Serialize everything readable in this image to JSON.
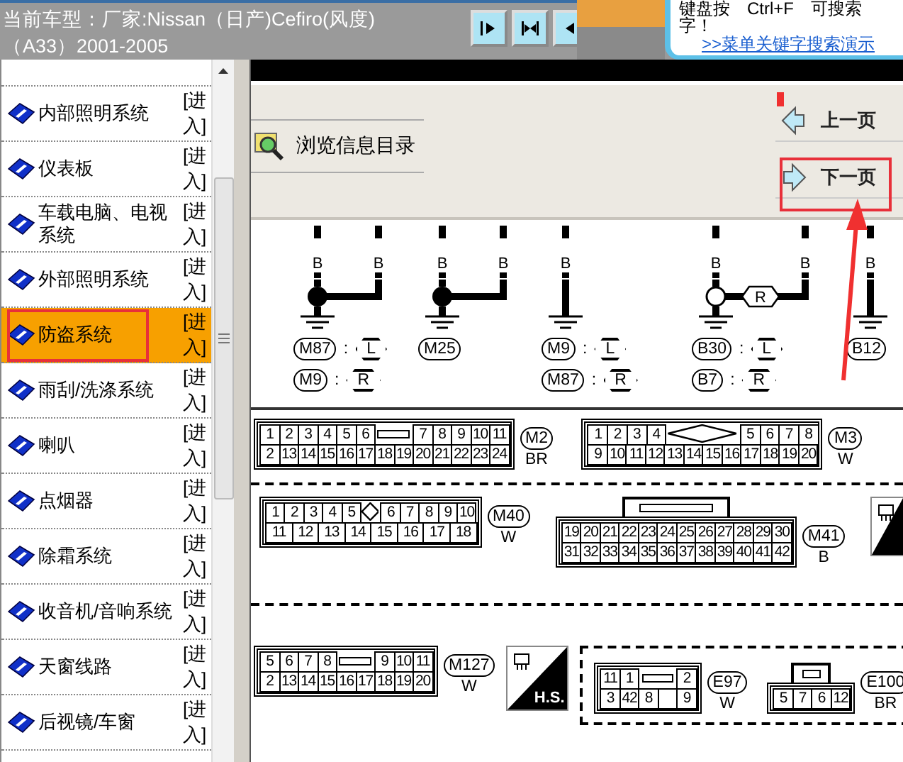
{
  "header": {
    "car_model": [
      "当前车型：厂家:Nissan（日产)Cefiro(风度)",
      "（A33）2001-2005"
    ],
    "toolbar_buttons": [
      {
        "kind": "arrow-right"
      },
      {
        "kind": "arrows-in"
      },
      {
        "kind": "arrow-left"
      }
    ],
    "tip": {
      "lines": [
        "键盘按　Ctrl+F　可搜索",
        "字！"
      ],
      "link": ">>菜单关键字搜索演示"
    }
  },
  "sidebar": {
    "items": [
      {
        "label": "内部照明系统",
        "action": "[进入]",
        "selected": false
      },
      {
        "label": "仪表板",
        "action": "[进入]",
        "selected": false
      },
      {
        "label": "车载电脑、电视系统",
        "action": "[进入]",
        "selected": false
      },
      {
        "label": "外部照明系统",
        "action": "[进入]",
        "selected": false
      },
      {
        "label": "防盗系统",
        "action": "[进入]",
        "selected": true
      },
      {
        "label": "雨刮/洗涤系统",
        "action": "[进入]",
        "selected": false
      },
      {
        "label": "喇叭",
        "action": "[进入]",
        "selected": false
      },
      {
        "label": "点烟器",
        "action": "[进入]",
        "selected": false
      },
      {
        "label": "除霜系统",
        "action": "[进入]",
        "selected": false
      },
      {
        "label": "收音机/音响系统",
        "action": "[进入]",
        "selected": false
      },
      {
        "label": "天窗线路",
        "action": "[进入]",
        "selected": false
      },
      {
        "label": "后视镜/车窗",
        "action": "[进入]",
        "selected": false
      }
    ]
  },
  "content": {
    "toolbar": {
      "browse_button": "浏览信息目录",
      "prev_button": "上一页",
      "next_button": "下一页"
    },
    "diagram": {
      "grounds": [
        {
          "kind": "filled-splice",
          "wires": [
            "B",
            "B"
          ],
          "labels": [
            {
              "connector": "M87",
              "separator": ":",
              "side": "L"
            },
            {
              "connector": "M9",
              "separator": ":",
              "side": "R"
            }
          ]
        },
        {
          "kind": "filled-splice",
          "wires": [
            "B",
            "B"
          ],
          "labels": [
            {
              "connector": "M25"
            }
          ]
        },
        {
          "kind": "direct",
          "wires": [
            "B"
          ],
          "labels": [
            {
              "connector": "M9",
              "separator": ":",
              "side": "L"
            },
            {
              "connector": "M87",
              "separator": ":",
              "side": "R"
            }
          ]
        },
        {
          "kind": "open-splice",
          "wires": [
            "B",
            "B"
          ],
          "splice_label": "R",
          "labels": [
            {
              "connector": "B30",
              "separator": ":",
              "side": "L"
            },
            {
              "connector": "B7",
              "separator": ":",
              "side": "R"
            }
          ]
        },
        {
          "kind": "direct",
          "wires": [
            "B"
          ],
          "labels": [
            {
              "connector": "B12"
            }
          ]
        }
      ],
      "connector_rows": [
        {
          "items": [
            {
              "kind": "connector",
              "name": "M2",
              "wire_code": "BR",
              "top_pins": [
                "1",
                "2",
                "3",
                "4",
                "5",
                "6",
                {
                  "kind": "slot"
                },
                "7",
                "8",
                "9",
                "10",
                "11"
              ],
              "bottom_pins": [
                "2",
                "13",
                "14",
                "15",
                "16",
                "17",
                "18",
                "19",
                "20",
                "21",
                "22",
                "23",
                "24"
              ]
            },
            {
              "kind": "connector",
              "name": "M3",
              "wire_code": "W",
              "top_pins": [
                "1",
                "2",
                "3",
                "4",
                {
                  "kind": "wide-diamond"
                },
                "5",
                "6",
                "7",
                "8"
              ],
              "bottom_pins": [
                "9",
                "10",
                "11",
                "12",
                "13",
                "14",
                "15",
                "16",
                "17",
                "18",
                "19",
                "20"
              ]
            }
          ]
        },
        {
          "items": [
            {
              "kind": "connector",
              "name": "M40",
              "wire_code": "W",
              "top_pins": [
                "1",
                "2",
                "3",
                "4",
                "5",
                {
                  "kind": "diamond"
                },
                "6",
                "7",
                "8",
                "9",
                "10"
              ],
              "bottom_pins": [
                "11",
                "12",
                "13",
                "14",
                "15",
                "16",
                "17",
                "18"
              ]
            },
            {
              "kind": "connector",
              "name": "M41",
              "wire_code": "B",
              "tab": true,
              "top_pins": [
                "19",
                "20",
                "21",
                "22",
                "23",
                "24",
                "25",
                "26",
                "27",
                "28",
                "29",
                "30"
              ],
              "bottom_pins": [
                "31",
                "32",
                "33",
                "34",
                "35",
                "36",
                "37",
                "38",
                "39",
                "40",
                "41",
                "42"
              ]
            },
            {
              "kind": "shield-icon"
            }
          ]
        },
        {
          "items": [
            {
              "kind": "connector",
              "name": "M127",
              "wire_code": "W",
              "top_pins": [
                "5",
                "6",
                "7",
                "8",
                {
                  "kind": "slot"
                },
                "9",
                "10",
                "11"
              ],
              "bottom_pins": [
                "2",
                "13",
                "14",
                "15",
                "16",
                "17",
                "18",
                "19",
                "20"
              ]
            },
            {
              "kind": "shield-icon",
              "text": "H.S."
            },
            {
              "kind": "group",
              "connectors": [
                {
                  "kind": "connector",
                  "name": "E97",
                  "wire_code": "W",
                  "top_pins": [
                    "11",
                    "1",
                    {
                      "kind": "slot"
                    },
                    "2"
                  ],
                  "bottom_pins": [
                    "3",
                    "42",
                    "8",
                    {
                      "kind": "blank"
                    },
                    "9"
                  ]
                },
                {
                  "kind": "connector",
                  "name": "E100",
                  "wire_code": "BR",
                  "tab": true,
                  "bottom_pins": [
                    "5",
                    "7",
                    "6",
                    "12"
                  ]
                }
              ]
            }
          ]
        }
      ]
    }
  }
}
